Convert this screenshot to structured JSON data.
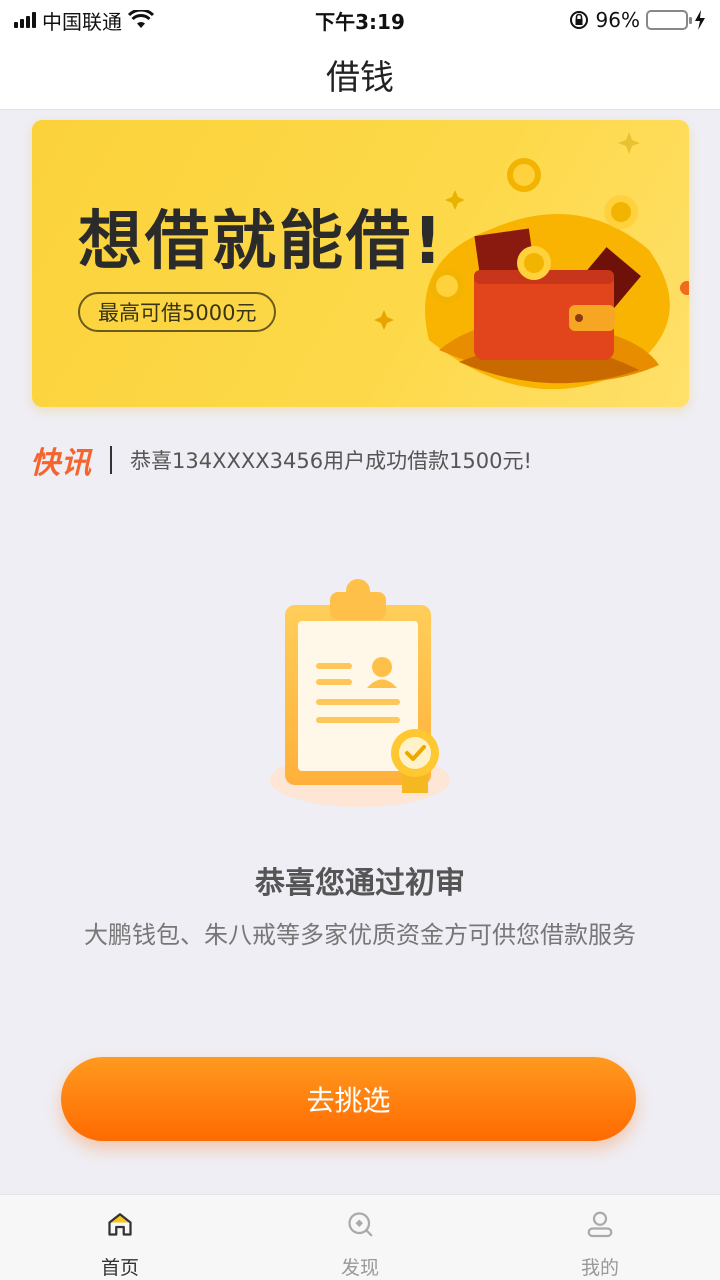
{
  "status_bar": {
    "carrier": "中国联通",
    "time": "下午3:19",
    "battery_percent": "96%",
    "battery_level": 0.96
  },
  "nav": {
    "title": "借钱"
  },
  "banner": {
    "headline": "想借就能借!",
    "pill_text": "最高可借5000元"
  },
  "ticker": {
    "logo_text": "快讯",
    "message": "恭喜134XXXX3456用户成功借款1500元!"
  },
  "result": {
    "title": "恭喜您通过初审",
    "subtitle": "大鹏钱包、朱八戒等多家优质资金方可供您借款服务"
  },
  "cta": {
    "label": "去挑选"
  },
  "tab_bar": {
    "tabs": [
      {
        "label": "首页",
        "icon": "home-icon",
        "active": true
      },
      {
        "label": "发现",
        "icon": "discover-icon",
        "active": false
      },
      {
        "label": "我的",
        "icon": "profile-icon",
        "active": false
      }
    ]
  },
  "colors": {
    "accent": "#ff7a0a",
    "banner_yellow": "#fdd94a",
    "ticker_logo": "#f6642c"
  }
}
